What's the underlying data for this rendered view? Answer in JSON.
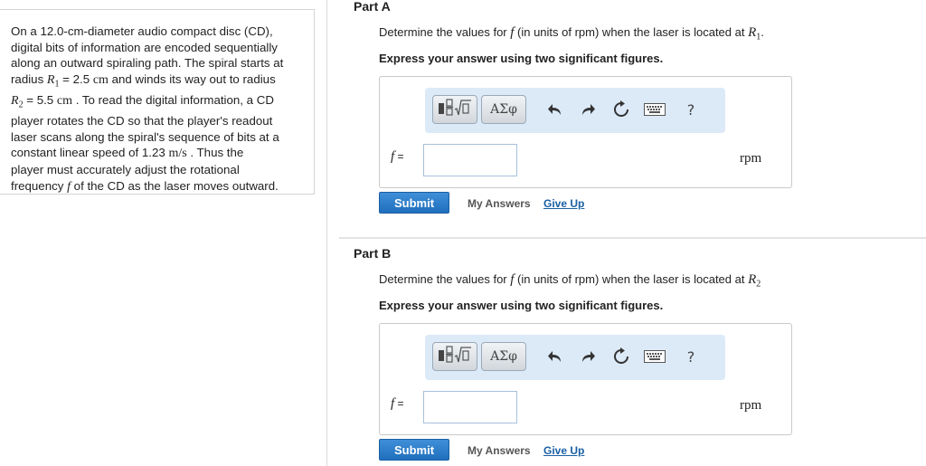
{
  "problem": {
    "line1": "On a 12.0-cm-diameter audio compact disc (CD),",
    "line2": "digital bits of information are encoded sequentially",
    "line3": "along an outward spiraling path. The spiral starts at",
    "line4_a": "radius ",
    "line4_var": "R",
    "line4_sub": "1",
    "line4_b": " = 2.5 ",
    "line4_unit": "cm",
    "line4_c": " and winds its way out to radius",
    "line5_var": "R",
    "line5_sub": "2",
    "line5_a": " = 5.5 ",
    "line5_unit": "cm",
    "line5_b": " . To read the digital information, a CD",
    "line6": "player rotates the CD so that the player's readout",
    "line7": "laser scans along the spiral's sequence of bits at a",
    "line8_a": "constant linear speed of 1.23 ",
    "line8_unit": "m/s",
    "line8_b": " . Thus the",
    "line9": "player must accurately adjust the rotational",
    "line10_a": "frequency ",
    "line10_var": "f",
    "line10_b": " of the CD as the laser moves outward."
  },
  "parts": [
    {
      "title": "Part A",
      "question_a": "Determine the values for ",
      "question_var": "f",
      "question_b": " (in units of rpm) when the laser is located at ",
      "question_r": "R",
      "question_sub": "1",
      "question_end": ".",
      "instruction": "Express your answer using two significant figures.",
      "symbols_label": "ΑΣφ",
      "f_var": "f",
      "f_eq": " =",
      "input_value": "",
      "unit": "rpm",
      "submit": "Submit",
      "my_answers": "My Answers",
      "give_up": "Give Up"
    },
    {
      "title": "Part B",
      "question_a": "Determine the values for ",
      "question_var": "f",
      "question_b": " (in units of rpm) when the laser is located at ",
      "question_r": "R",
      "question_sub": "2",
      "question_end": "",
      "instruction": "Express your answer using two significant figures.",
      "symbols_label": "ΑΣφ",
      "f_var": "f",
      "f_eq": " =",
      "input_value": "",
      "unit": "rpm",
      "submit": "Submit",
      "my_answers": "My Answers",
      "give_up": "Give Up"
    }
  ],
  "toolbar": {
    "help": "?",
    "icons": [
      "templates-icon",
      "symbols-icon",
      "undo-icon",
      "redo-icon",
      "reset-icon",
      "keyboard-icon",
      "help-icon"
    ]
  },
  "colors": {
    "toolbar_bg": "#dce9f7",
    "submit_bg": "#2a7cc7",
    "link": "#1a5fa3"
  }
}
